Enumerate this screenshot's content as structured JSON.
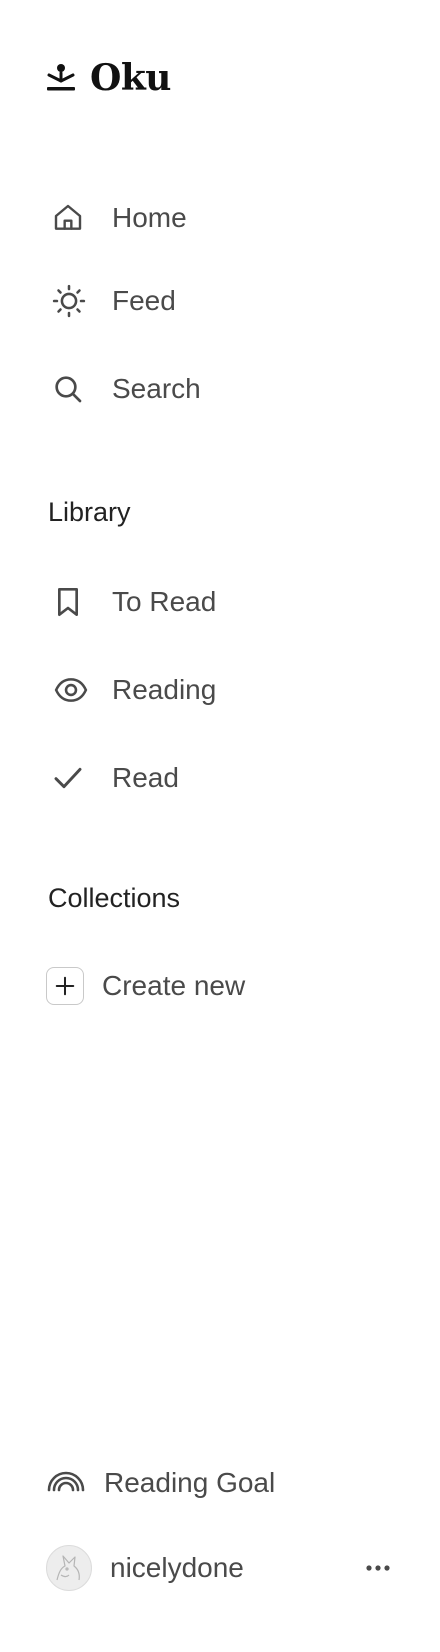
{
  "brand": {
    "name": "Oku"
  },
  "nav": {
    "home": "Home",
    "feed": "Feed",
    "search": "Search"
  },
  "library": {
    "title": "Library",
    "to_read": "To Read",
    "reading": "Reading",
    "read": "Read"
  },
  "collections": {
    "title": "Collections",
    "create_new": "Create new"
  },
  "footer": {
    "reading_goal": "Reading Goal",
    "username": "nicelydone"
  },
  "colors": {
    "text": "#4a4a4a",
    "heading": "#222222",
    "icon": "#4a4a4a",
    "background": "#ffffff"
  }
}
